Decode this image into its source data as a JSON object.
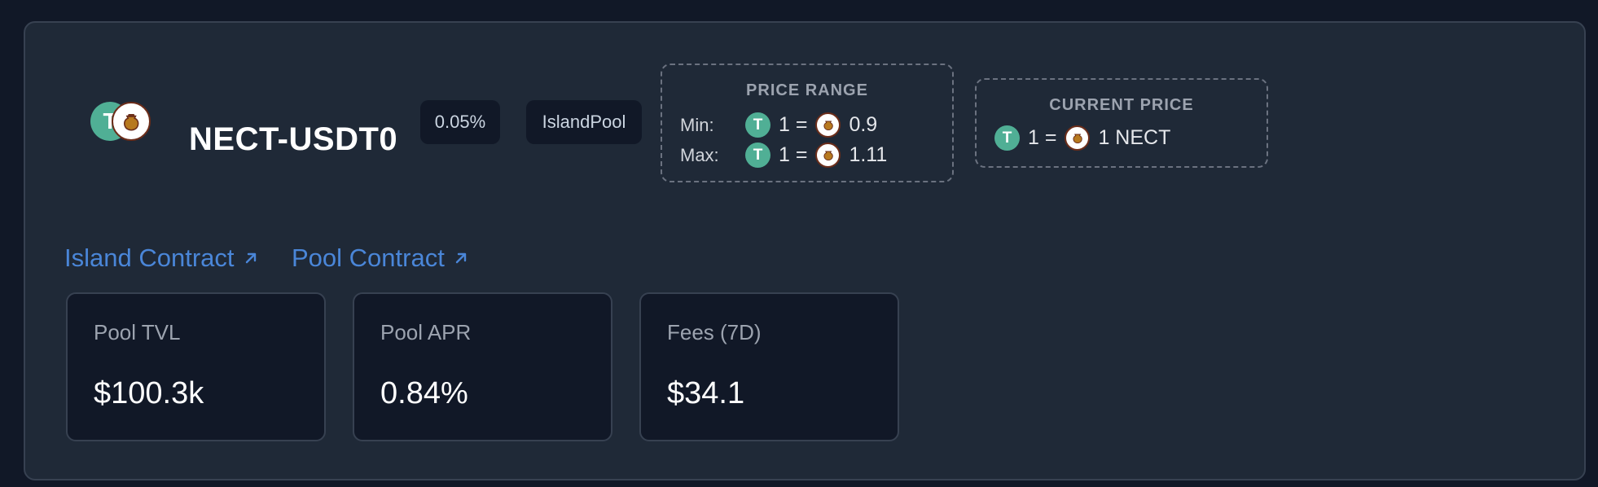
{
  "pool": {
    "pair_name": "NECT-USDT0",
    "fee_tier": "0.05%",
    "pool_type": "IslandPool",
    "token_a_icon": "usdt0-token-icon",
    "token_b_icon": "nect-token-icon"
  },
  "price_range": {
    "title": "PRICE RANGE",
    "min_label": "Min:",
    "min_lhs": "1 =",
    "min_value": "0.9",
    "max_label": "Max:",
    "max_lhs": "1 =",
    "max_value": "1.11"
  },
  "current_price": {
    "title": "CURRENT PRICE",
    "lhs": "1 =",
    "value": "1 NECT"
  },
  "links": {
    "island_contract": "Island Contract",
    "pool_contract": "Pool Contract"
  },
  "stats": [
    {
      "label": "Pool TVL",
      "value": "$100.3k"
    },
    {
      "label": "Pool APR",
      "value": "0.84%"
    },
    {
      "label": "Fees (7D)",
      "value": "$34.1"
    }
  ],
  "colors": {
    "background": "#111827",
    "card": "#1f2937",
    "link": "#4a86d8",
    "usdt_token": "#50af95"
  }
}
